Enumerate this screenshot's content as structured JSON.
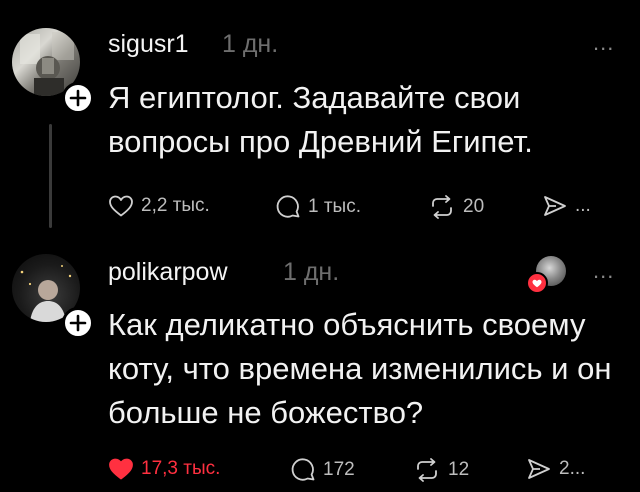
{
  "post1": {
    "username": "sigusr1",
    "time": "1 дн.",
    "more": "...",
    "text_line1": "Я египтолог. Задавайте свои",
    "text_line2": "вопросы про Древний Египет.",
    "likes": "2,2 тыс.",
    "replies": "1 тыс.",
    "reposts": "20",
    "shares": "..."
  },
  "post2": {
    "username": "polikarpow",
    "time": "1 дн.",
    "more": "...",
    "text_line1": "Как деликатно объяснить своему",
    "text_line2": "коту, что времена изменились и он",
    "text_line3": "больше не божество?",
    "likes": "17,3 тыс.",
    "replies": "172",
    "reposts": "12",
    "shares": "2..."
  },
  "colors": {
    "background": "#000000",
    "like_active": "#ff3040",
    "muted": "#6e6e6e"
  }
}
